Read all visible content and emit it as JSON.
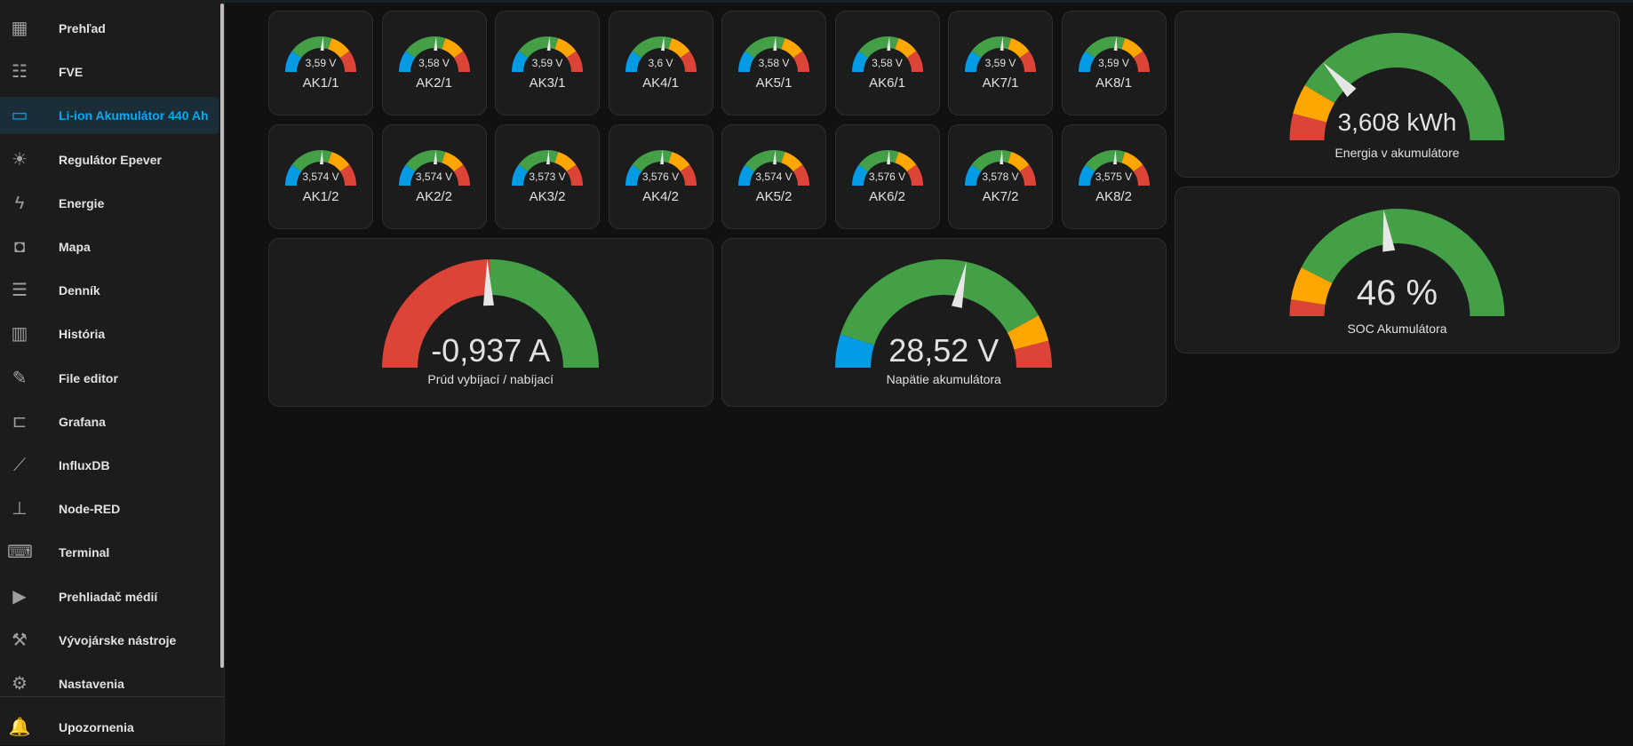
{
  "sidebar": {
    "items": [
      {
        "label": "Prehľad",
        "icon": "dashboard-icon",
        "glyph": "▦"
      },
      {
        "label": "FVE",
        "icon": "solar-panel-icon",
        "glyph": "☷"
      },
      {
        "label": "Li-ion Akumulátor 440 Ah",
        "icon": "battery-charging-icon",
        "glyph": "▭",
        "active": true
      },
      {
        "label": "Regulátor Epever",
        "icon": "sun-icon",
        "glyph": "☀"
      },
      {
        "label": "Energie",
        "icon": "lightning-icon",
        "glyph": "ϟ"
      },
      {
        "label": "Mapa",
        "icon": "map-account-icon",
        "glyph": "◘"
      },
      {
        "label": "Denník",
        "icon": "logbook-list-icon",
        "glyph": "☰"
      },
      {
        "label": "História",
        "icon": "chart-box-icon",
        "glyph": "▥"
      },
      {
        "label": "File editor",
        "icon": "wrench-icon",
        "glyph": "✎"
      },
      {
        "label": "Grafana",
        "icon": "grafana-icon",
        "glyph": "⊏"
      },
      {
        "label": "InfluxDB",
        "icon": "line-chart-icon",
        "glyph": "⟋"
      },
      {
        "label": "Node-RED",
        "icon": "sitemap-icon",
        "glyph": "⊥"
      },
      {
        "label": "Terminal",
        "icon": "terminal-icon",
        "glyph": "⌨"
      },
      {
        "label": "Prehliadač médií",
        "icon": "media-play-icon",
        "glyph": "▶"
      },
      {
        "label": "Vývojárske nástroje",
        "icon": "hammer-icon",
        "glyph": "⚒"
      },
      {
        "label": "Nastavenia",
        "icon": "gear-icon",
        "glyph": "⚙"
      }
    ],
    "notifications": {
      "label": "Upozornenia",
      "icon": "bell-icon",
      "glyph": "🔔"
    }
  },
  "colors": {
    "green": "#43a047",
    "orange": "#ffa600",
    "red": "#db4437",
    "blue": "#039be5",
    "accent": "#03a9f4"
  },
  "cells": [
    {
      "name": "AK1/1",
      "value": 3.59,
      "display": "3,59 V"
    },
    {
      "name": "AK2/1",
      "value": 3.58,
      "display": "3,58 V"
    },
    {
      "name": "AK3/1",
      "value": 3.59,
      "display": "3,59 V"
    },
    {
      "name": "AK4/1",
      "value": 3.6,
      "display": "3,6 V"
    },
    {
      "name": "AK5/1",
      "value": 3.58,
      "display": "3,58 V"
    },
    {
      "name": "AK6/1",
      "value": 3.58,
      "display": "3,58 V"
    },
    {
      "name": "AK7/1",
      "value": 3.59,
      "display": "3,59 V"
    },
    {
      "name": "AK8/1",
      "value": 3.59,
      "display": "3,59 V"
    },
    {
      "name": "AK1/2",
      "value": 3.574,
      "display": "3,574 V"
    },
    {
      "name": "AK2/2",
      "value": 3.574,
      "display": "3,574 V"
    },
    {
      "name": "AK3/2",
      "value": 3.573,
      "display": "3,573 V"
    },
    {
      "name": "AK4/2",
      "value": 3.576,
      "display": "3,576 V"
    },
    {
      "name": "AK5/2",
      "value": 3.574,
      "display": "3,574 V"
    },
    {
      "name": "AK6/2",
      "value": 3.576,
      "display": "3,576 V"
    },
    {
      "name": "AK7/2",
      "value": 3.578,
      "display": "3,578 V"
    },
    {
      "name": "AK8/2",
      "value": 3.575,
      "display": "3,575 V"
    }
  ],
  "cell_gauge": {
    "min": 2.6,
    "max": 4.5,
    "segments": [
      {
        "from": 2.6,
        "to": 2.98,
        "color": "blue"
      },
      {
        "from": 2.98,
        "to": 3.74,
        "color": "green"
      },
      {
        "from": 3.74,
        "to": 4.12,
        "color": "orange"
      },
      {
        "from": 4.12,
        "to": 4.5,
        "color": "red"
      }
    ]
  },
  "current": {
    "name": "Prúd vybíjací / nabíjací",
    "value": -0.937,
    "display": "-0,937 A",
    "min": -50,
    "max": 50,
    "segments": [
      {
        "from": -50,
        "to": 0,
        "color": "red"
      },
      {
        "from": 0,
        "to": 50,
        "color": "green"
      }
    ]
  },
  "voltage": {
    "name": "Napätie akumulátora",
    "value": 28.52,
    "display": "28,52 V",
    "min": 20,
    "max": 35,
    "segments": [
      {
        "from": 20,
        "to": 21.5,
        "color": "blue"
      },
      {
        "from": 21.5,
        "to": 32.6,
        "color": "green"
      },
      {
        "from": 32.6,
        "to": 33.8,
        "color": "orange"
      },
      {
        "from": 33.8,
        "to": 35,
        "color": "red"
      }
    ]
  },
  "energy": {
    "name": "Energia v akumulátore",
    "value": 3.608,
    "display": "3,608 kWh",
    "min": 0,
    "max": 14,
    "segments": [
      {
        "from": 0,
        "to": 1.12,
        "color": "red"
      },
      {
        "from": 1.12,
        "to": 2.4,
        "color": "orange"
      },
      {
        "from": 2.4,
        "to": 14,
        "color": "green"
      }
    ]
  },
  "soc": {
    "name": "SOC Akumulátora",
    "value": 46,
    "display": "46 %",
    "min": 0,
    "max": 100,
    "segments": [
      {
        "from": 0,
        "to": 5,
        "color": "red"
      },
      {
        "from": 5,
        "to": 15,
        "color": "orange"
      },
      {
        "from": 15,
        "to": 100,
        "color": "green"
      }
    ]
  }
}
